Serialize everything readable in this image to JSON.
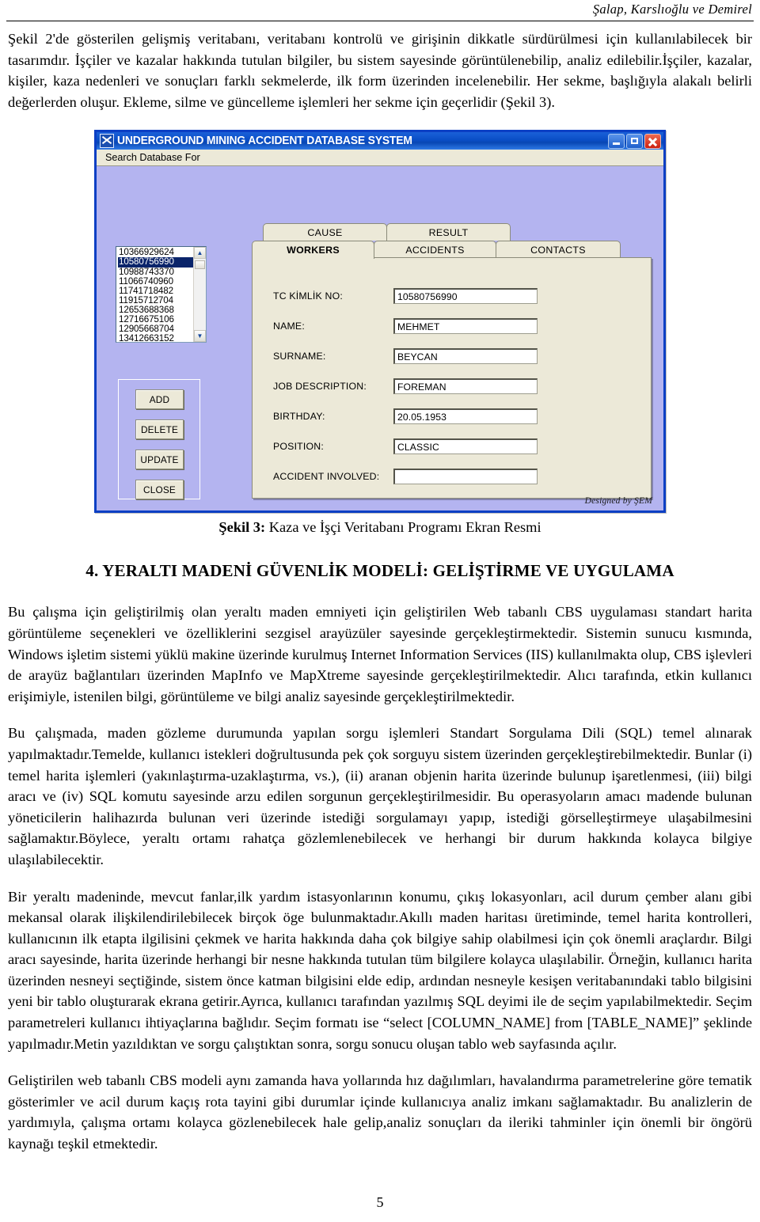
{
  "header": {
    "running_head": "Şalap, Karslıoğlu ve  Demirel"
  },
  "body": {
    "para1": "Şekil 2'de gösterilen gelişmiş veritabanı, veritabanı kontrolü ve girişinin dikkatle sürdürülmesi için kullanılabilecek bir tasarımdır. İşçiler ve kazalar hakkında tutulan bilgiler, bu sistem sayesinde görüntülenebilip, analiz edilebilir.İşçiler, kazalar, kişiler, kaza nedenleri ve sonuçları farklı sekmelerde, ilk form üzerinden incelenebilir. Her sekme, başlığıyla alakalı belirli değerlerden oluşur. Ekleme, silme ve güncelleme işlemleri her sekme için geçerlidir (Şekil 3).",
    "figure_caption_label": "Şekil 3:",
    "figure_caption_text": " Kaza ve İşçi Veritabanı Programı Ekran Resmi",
    "section_title": "4. YERALTI MADENİ GÜVENLİK MODELİ: GELİŞTİRME VE UYGULAMA",
    "para2": "Bu çalışma için geliştirilmiş olan yeraltı maden emniyeti için geliştirilen Web tabanlı CBS uygulaması standart harita görüntüleme seçenekleri ve özelliklerini  sezgisel arayüzüler sayesinde gerçekleştirmektedir. Sistemin sunucu kısmında, Windows işletim sistemi yüklü makine üzerinde kurulmuş Internet Information Services (IIS) kullanılmakta olup, CBS   işlevleri de arayüz bağlantıları üzerinden MapInfo ve MapXtreme sayesinde gerçekleştirilmektedir. Alıcı tarafında, etkin kullanıcı erişimiyle, istenilen bilgi, görüntüleme ve bilgi analiz sayesinde gerçekleştirilmektedir.",
    "para3": "Bu çalışmada, maden gözleme durumunda yapılan sorgu işlemleri Standart Sorgulama Dili (SQL) temel alınarak yapılmaktadır.Temelde, kullanıcı istekleri doğrultusunda pek çok sorguyu sistem üzerinden gerçekleştirebilmektedir. Bunlar (i) temel harita işlemleri (yakınlaştırma-uzaklaştırma, vs.), (ii) aranan objenin harita üzerinde bulunup işaretlenmesi, (iii) bilgi aracı ve (iv) SQL komutu sayesinde arzu edilen sorgunun gerçekleştirilmesidir. Bu operasyoların amacı madende bulunan yöneticilerin halihazırda bulunan veri üzerinde istediği sorgulamayı yapıp, istediği görselleştirmeye ulaşabilmesini sağlamaktır.Böylece, yeraltı ortamı rahatça gözlemlenebilecek ve herhangi bir durum hakkında kolayca bilgiye ulaşılabilecektir.",
    "para4": "Bir yeraltı madeninde, mevcut fanlar,ilk yardım istasyonlarının konumu, çıkış lokasyonları, acil durum çember alanı gibi mekansal olarak ilişkilendirilebilecek birçok öge bulunmaktadır.Akıllı maden haritası üretiminde, temel harita kontrolleri, kullanıcının ilk etapta ilgilisini çekmek ve harita hakkında daha çok bilgiye sahip olabilmesi için çok önemli araçlardır. Bilgi aracı sayesinde, harita üzerinde herhangi bir nesne hakkında tutulan tüm bilgilere kolayca ulaşılabilir. Örneğin, kullanıcı harita üzerinden nesneyi seçtiğinde, sistem önce katman bilgisini elde edip, ardından nesneyle kesişen veritabanındaki tablo bilgisini yeni bir tablo oluşturarak ekrana getirir.Ayrıca, kullanıcı tarafından yazılmış SQL deyimi ile de seçim yapılabilmektedir. Seçim parametreleri kullanıcı ihtiyaçlarına bağlıdır. Seçim formatı ise “select [COLUMN_NAME] from [TABLE_NAME]” şeklinde yapılmadır.Metin yazıldıktan ve sorgu çalıştıktan sonra, sorgu sonucu oluşan tablo web sayfasında açılır.",
    "para5": "Geliştirilen web tabanlı CBS modeli aynı zamanda hava yollarında hız dağılımları, havalandırma parametrelerine göre tematik gösterimler ve acil durum kaçış rota tayini gibi durumlar içinde kullanıcıya analiz imkanı sağlamaktadır. Bu analizlerin de yardımıyla, çalışma ortamı kolayca gözlenebilecek hale gelip,analiz sonuçları da ileriki tahminler için önemli bir öngörü kaynağı teşkil etmektedir.",
    "page_number": "5"
  },
  "app": {
    "title": "UNDERGROUND MINING ACCIDENT DATABASE SYSTEM",
    "menu": [
      {
        "label": "Search Database For"
      }
    ],
    "title_buttons": [
      {
        "name": "minimize"
      },
      {
        "name": "maximize"
      },
      {
        "name": "close"
      }
    ],
    "listbox": {
      "items": [
        "10366929624",
        "10580756990",
        "10988743370",
        "11066740960",
        "11741718482",
        "11915712704",
        "12653688368",
        "12716675106",
        "12905668704",
        "13412663152"
      ],
      "selected_index": 1
    },
    "buttons": [
      {
        "label": "ADD"
      },
      {
        "label": "DELETE"
      },
      {
        "label": "UPDATE"
      },
      {
        "label": "CLOSE"
      }
    ],
    "tabs_top": [
      {
        "label": "CAUSE"
      },
      {
        "label": "RESULT"
      }
    ],
    "tabs_bottom": [
      {
        "label": "WORKERS",
        "selected": true
      },
      {
        "label": "ACCIDENTS",
        "selected": false
      },
      {
        "label": "CONTACTS",
        "selected": false
      }
    ],
    "form_fields": [
      {
        "label": "TC KİMLİK NO:",
        "value": "10580756990"
      },
      {
        "label": "NAME:",
        "value": "MEHMET"
      },
      {
        "label": "SURNAME:",
        "value": "BEYCAN"
      },
      {
        "label": "JOB DESCRIPTION:",
        "value": "FOREMAN"
      },
      {
        "label": "BIRTHDAY:",
        "value": "20.05.1953"
      },
      {
        "label": "POSITION:",
        "value": "CLASSIC"
      },
      {
        "label": "ACCIDENT INVOLVED:",
        "value": ""
      }
    ],
    "designed_by": "Designed by ŞEM",
    "colors": {
      "titlebar": "#0a4ec6",
      "window_body": "#b4b4f0",
      "control_face": "#ece9d8",
      "selection": "#0a246a",
      "window_border": "#0b3fc4"
    }
  }
}
